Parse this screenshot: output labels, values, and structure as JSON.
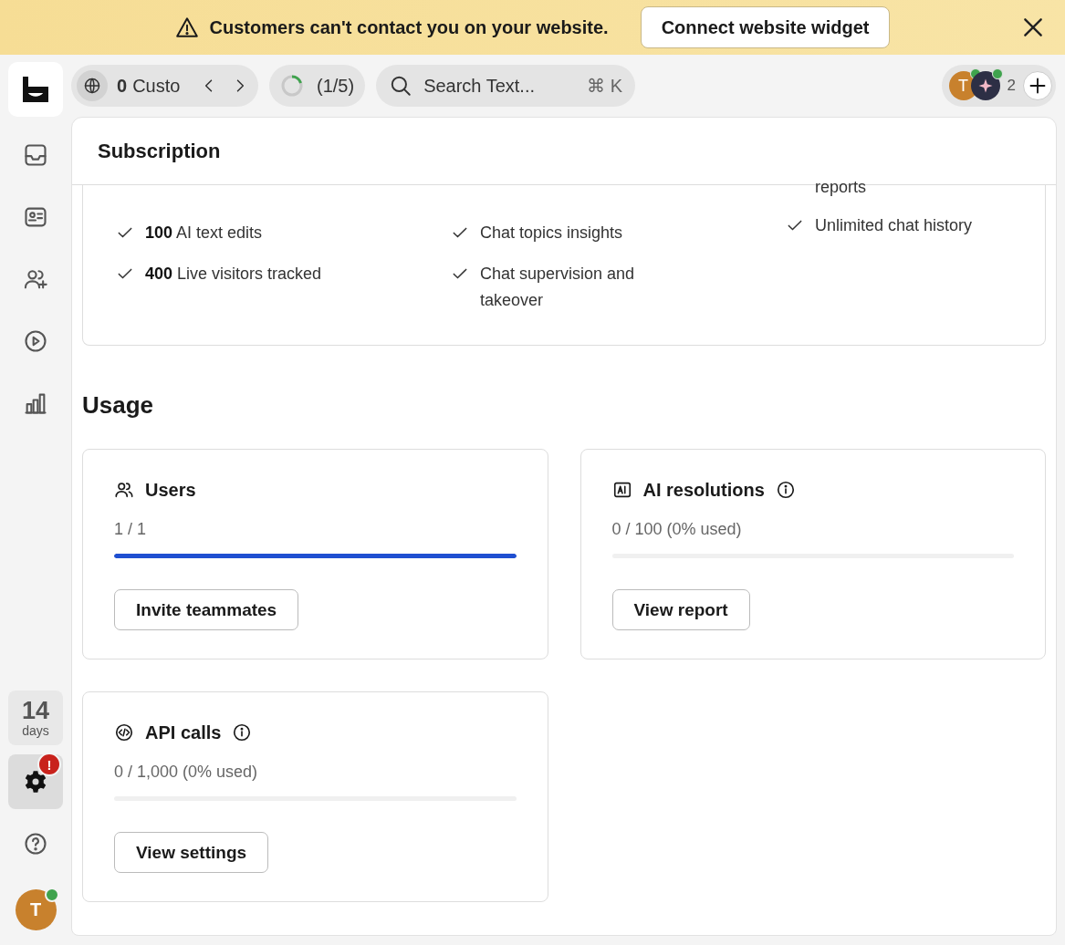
{
  "banner": {
    "message": "Customers can't contact you on your website.",
    "button": "Connect website widget"
  },
  "sidebar": {
    "nav": [
      {
        "kind": "inbox",
        "selected": false
      },
      {
        "kind": "contacts",
        "selected": false
      },
      {
        "kind": "people",
        "selected": false
      },
      {
        "kind": "play",
        "selected": false
      },
      {
        "kind": "chart",
        "selected": false
      }
    ],
    "trial": {
      "number": "14",
      "unit": "days"
    },
    "bottom": [
      {
        "kind": "settings",
        "selected": true,
        "badge": "!"
      },
      {
        "kind": "help",
        "selected": false
      }
    ],
    "avatar": {
      "initial": "T",
      "online": true
    }
  },
  "topbar": {
    "customers": {
      "count": "0",
      "label": "Custo"
    },
    "progress": {
      "text": "(1/5)",
      "level": 0.2
    },
    "search": {
      "placeholder": "Search Text...",
      "shortcut": "⌘ K"
    },
    "team": {
      "avatars": [
        {
          "kind": "letter",
          "initial": "T",
          "online": true
        },
        {
          "kind": "bot",
          "online": true
        }
      ],
      "count": "2"
    }
  },
  "page": {
    "title": "Subscription",
    "features": [
      {
        "items": [
          "**100** AI text edits",
          "**400** Live visitors tracked"
        ]
      },
      {
        "items": [
          "Chat topics insights",
          "Chat supervision and takeover"
        ]
      },
      {
        "partial": "reports",
        "items": [
          "Unlimited chat history"
        ]
      }
    ],
    "usage": {
      "heading": "Usage",
      "cards": [
        {
          "title": "Users",
          "info": false,
          "reading": "1 / 1",
          "level": 1,
          "button": "Invite teammates"
        },
        {
          "title": "AI resolutions",
          "info": true,
          "reading": "0 / 100 (0% used)",
          "level": 0,
          "button": "View report"
        },
        {
          "title": "API calls",
          "info": true,
          "reading": "0 / 1,000 (0% used)",
          "level": 0,
          "button": "View settings"
        }
      ]
    }
  }
}
